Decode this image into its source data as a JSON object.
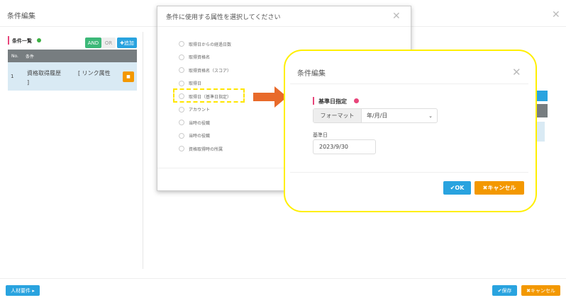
{
  "main": {
    "title": "条件編集",
    "section_title": "条件一覧",
    "and_label": "AND",
    "or_label": "OR",
    "add_label": "✚追加",
    "table": {
      "headers": [
        "No.",
        "条件"
      ],
      "rows": [
        {
          "no": "1",
          "condition": "資格取得履歴",
          "link": "[ リンク属性",
          "link_tail": "]"
        }
      ]
    },
    "footer": {
      "left_button": "人材要件 ▸",
      "save": "✔保存",
      "cancel": "✖キャンセル"
    }
  },
  "attr_dialog": {
    "title": "条件に使用する属性を選択してください",
    "options": [
      "取得日からの経過日数",
      "取得資格名",
      "取得資格名（スコア）",
      "取得日",
      "取得日（基準日指定）",
      "アカウント",
      "当時の役職",
      "当時の役職",
      "資格取得時の所属"
    ]
  },
  "edit_dialog": {
    "title": "条件編集",
    "section_title": "基準日指定",
    "format_label": "フォーマット",
    "format_value": "年/月/日",
    "date_label": "基準日",
    "date_value": "2023/9/30",
    "ok": "✔OK",
    "cancel": "✖キャンセル"
  },
  "colors": {
    "blue": "#29a3df",
    "orange": "#f39800",
    "green": "#3cb878",
    "highlight": "#ffef00",
    "arrow": "#e86a2a"
  }
}
